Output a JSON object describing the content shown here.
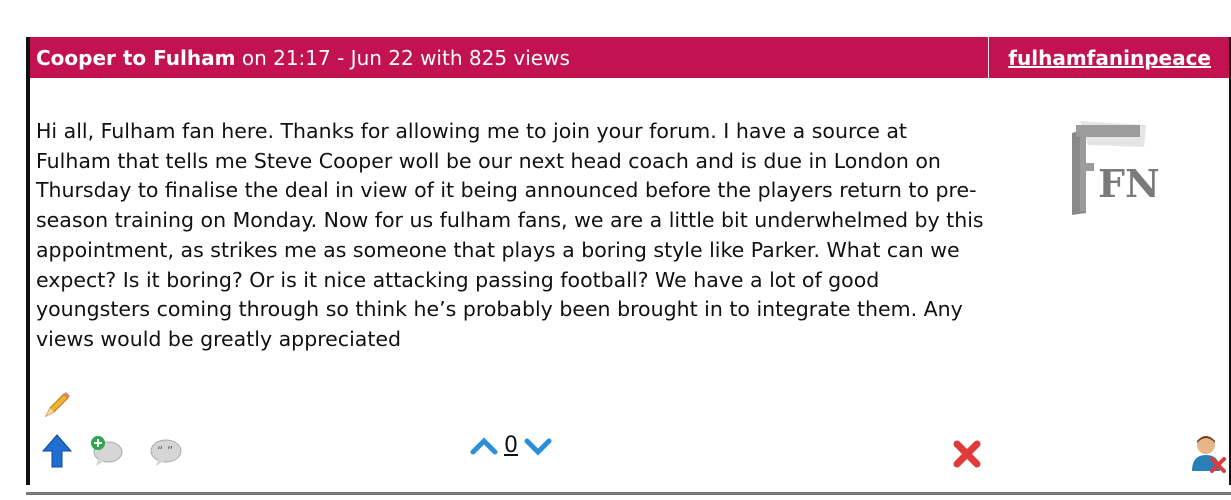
{
  "post": {
    "title": "Cooper to Fulham",
    "meta": " on 21:17 - Jun 22 with 825 views",
    "author": "fulhamfaninpeace",
    "body": "Hi all, Fulham fan here. Thanks for allowing me to join your forum. I have a source at Fulham that tells me Steve Cooper woll be our next head coach and is due in London on Thursday to finalise the deal in view of it being announced before the players return to pre-season training on Monday. Now for us fulham fans, we are a little bit underwhelmed by this appointment, as strikes me as someone that plays a boring style like Parker. What can we expect? Is it boring? Or is it nice attacking passing football? We have a lot of good youngsters coming through so think he’s probably been brought in to integrate them. Any views would be greatly appreciated",
    "avatar_text": "FN",
    "vote_count": "0"
  },
  "colors": {
    "header_bg": "#c2124f",
    "header_text": "#ffffff",
    "vote_arrow": "#2a8fd6",
    "delete_red": "#e03a3a",
    "up_blue": "#1f6fd0"
  },
  "icons": {
    "edit": "pencil-icon",
    "top": "up-arrow-icon",
    "reply": "reply-bubble-icon",
    "quote": "quote-bubble-icon",
    "vote_up": "chevron-up-icon",
    "vote_down": "chevron-down-icon",
    "delete": "delete-x-icon",
    "ignore": "ignore-user-icon"
  }
}
